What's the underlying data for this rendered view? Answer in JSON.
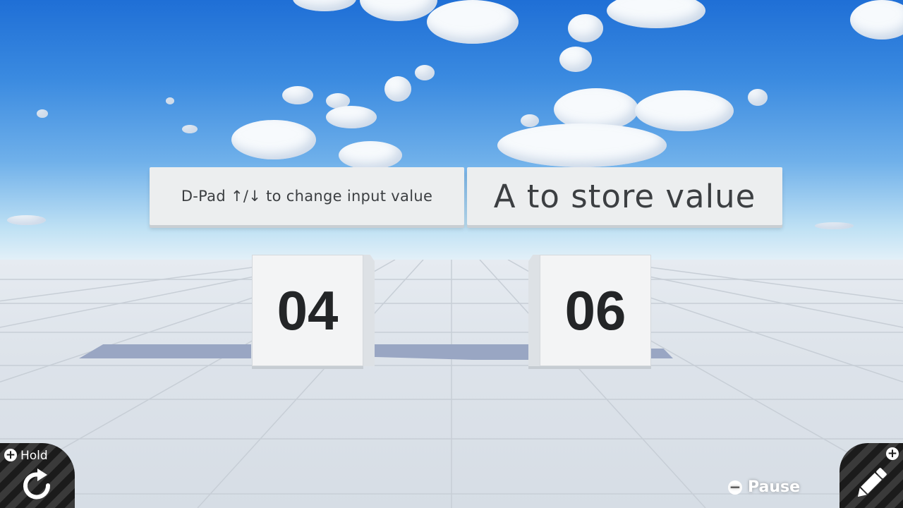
{
  "instructions": {
    "left": "D-Pad ↑/↓ to change input value",
    "right": "A to store value"
  },
  "cubes": {
    "left_value": "04",
    "right_value": "06"
  },
  "hud": {
    "hold_label": "Hold",
    "pause_label": "Pause",
    "plus_symbol": "+",
    "minus_symbol": "−"
  },
  "icons": {
    "reset": "rotate-icon",
    "edit": "pencil-icon"
  }
}
